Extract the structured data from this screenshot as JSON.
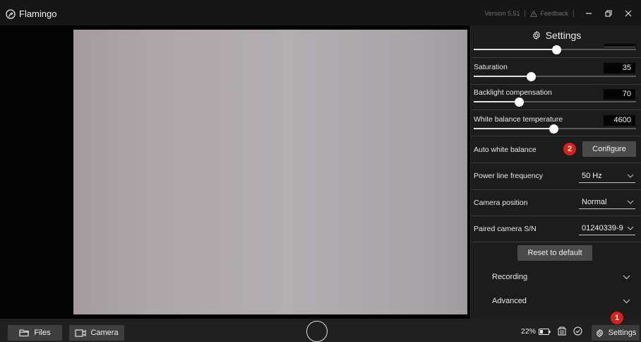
{
  "titlebar": {
    "app_name": "Flamingo",
    "version": "Version 5.51",
    "feedback": "Feedback"
  },
  "settings": {
    "title": "Settings",
    "top_slider_level": 0.51,
    "saturation": {
      "label": "Saturation",
      "value": "35",
      "level": 0.35
    },
    "backlight": {
      "label": "Backlight compensation",
      "value": "70",
      "level": 0.28
    },
    "white_balance_temp": {
      "label": "White balance temperature",
      "value": "4600",
      "level": 0.49
    },
    "auto_white_balance": {
      "label": "Auto white balance",
      "badge": "2",
      "button": "Configure"
    },
    "power_line": {
      "label": "Power line frequency",
      "value": "50 Hz"
    },
    "camera_position": {
      "label": "Camera position",
      "value": "Normal"
    },
    "paired_camera": {
      "label": "Paired camera S/N",
      "value": "01240339-9"
    },
    "reset_button": "Reset to default",
    "sections": [
      "Recording",
      "Advanced"
    ]
  },
  "bottombar": {
    "files_label": "Files",
    "camera_label": "Camera",
    "battery": "22%",
    "settings_label": "Settings",
    "settings_badge": "1"
  },
  "colors": {
    "accent_badge": "#d9201a",
    "panel_bg": "#1c1c1c",
    "titlebar_bg": "#161616"
  }
}
